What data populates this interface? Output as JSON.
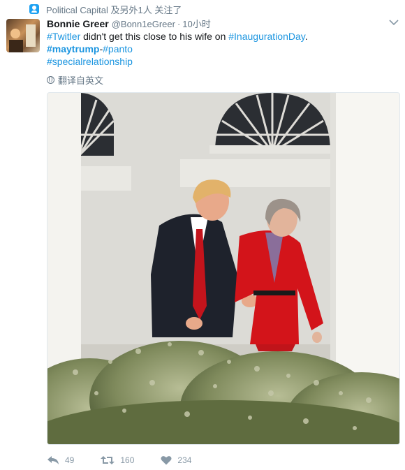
{
  "context": {
    "icon": "user-follow-icon",
    "text": "Political Capital 及另外1人 关注了"
  },
  "tweet": {
    "author_name": "Bonnie Greer",
    "author_handle": "@Bonn1eGreer",
    "separator": "·",
    "time": "10小时",
    "text_lines": [
      [
        {
          "text": "#Twitler",
          "tag": true
        },
        {
          "text": " didn't get this close to his wife  on  ",
          "tag": false
        },
        {
          "text": "#InaugurationDay",
          "tag": true
        },
        {
          "text": ".",
          "tag": false
        }
      ],
      [
        {
          "text": "#maytrump",
          "tag": true,
          "bold": true
        },
        {
          "text": "-",
          "tag": false
        },
        {
          "text": "#panto",
          "tag": true
        }
      ],
      [
        {
          "text": "#specialrelationship",
          "tag": true
        }
      ]
    ],
    "translate_label": "翻译自英文",
    "actions": {
      "reply_count": "49",
      "retweet_count": "160",
      "like_count": "234"
    }
  },
  "colors": {
    "link": "#1b95e0",
    "muted": "#657786",
    "accent": "#1da1f2"
  }
}
